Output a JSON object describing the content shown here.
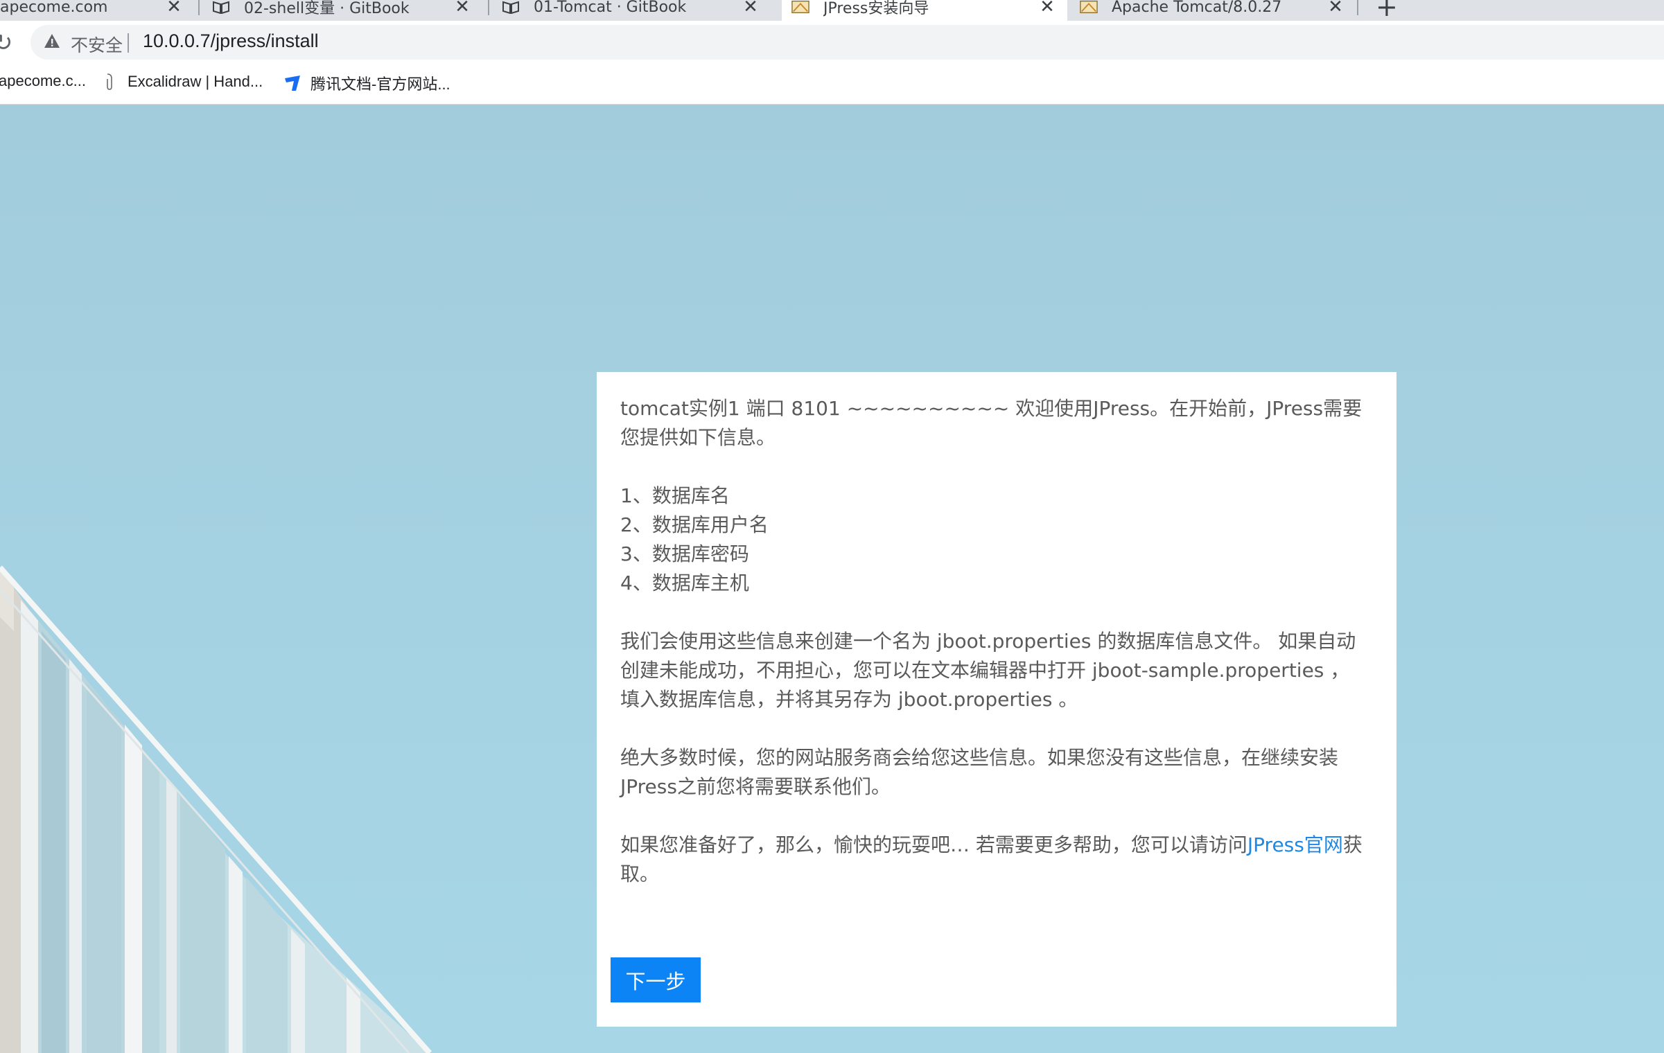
{
  "browser": {
    "tabs": [
      {
        "title": "apecome.com",
        "active": false
      },
      {
        "title": "02-shell变量 · GitBook",
        "active": false
      },
      {
        "title": "01-Tomcat · GitBook",
        "active": false
      },
      {
        "title": "JPress安装向导",
        "active": true
      },
      {
        "title": "Apache Tomcat/8.0.27",
        "active": false
      }
    ],
    "omnibox": {
      "security_label": "不安全",
      "url": "10.0.0.7/jpress/install"
    },
    "bookmarks": [
      {
        "label": "apecome.c...",
        "icon": "site-icon"
      },
      {
        "label": "Excalidraw | Hand...",
        "icon": "excalidraw-icon"
      },
      {
        "label": "腾讯文档-官方网站...",
        "icon": "tencent-docs-icon"
      }
    ]
  },
  "page": {
    "intro": "tomcat实例1 端口 8101 ~~~~~~~~~~ 欢迎使用JPress。在开始前，JPress需要您提供如下信息。",
    "list": [
      "1、数据库名",
      "2、数据库用户名",
      "3、数据库密码",
      "4、数据库主机"
    ],
    "para_config": "我们会使用这些信息来创建一个名为 jboot.properties 的数据库信息文件。 如果自动创建未能成功，不用担心，您可以在文本编辑器中打开 jboot-sample.properties ， 填入数据库信息，并将其另存为 jboot.properties 。",
    "para_provider": "绝大多数时候，您的网站服务商会给您这些信息。如果您没有这些信息，在继续安装JPress之前您将需要联系他们。",
    "para_help_before": "如果您准备好了，那么，愉快的玩耍吧… 若需要更多帮助，您可以请访问",
    "help_link": "JPress官网",
    "para_help_after": "获取。",
    "next_button": "下一步"
  },
  "colors": {
    "sky": "#a5d2e2",
    "link": "#1e88e5",
    "button": "#0d84f5"
  }
}
